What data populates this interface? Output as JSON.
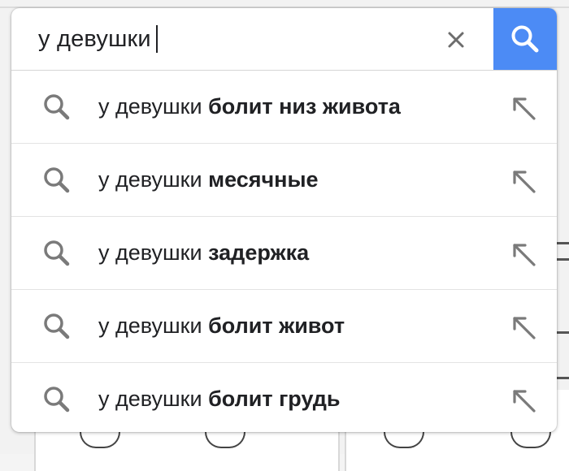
{
  "search": {
    "query": "у девушки",
    "clear_icon": "close-icon",
    "submit_icon": "search-icon",
    "submit_color": "#4c8bf5"
  },
  "suggestions": [
    {
      "prefix": "у девушки",
      "completion": "болит низ живота",
      "icon": "search-icon",
      "action_icon": "arrow-up-left-icon"
    },
    {
      "prefix": "у девушки",
      "completion": "месячные",
      "icon": "search-icon",
      "action_icon": "arrow-up-left-icon"
    },
    {
      "prefix": "у девушки",
      "completion": "задержка",
      "icon": "search-icon",
      "action_icon": "arrow-up-left-icon"
    },
    {
      "prefix": "у девушки",
      "completion": "болит живот",
      "icon": "search-icon",
      "action_icon": "arrow-up-left-icon"
    },
    {
      "prefix": "у девушки",
      "completion": "болит грудь",
      "icon": "search-icon",
      "action_icon": "arrow-up-left-icon"
    }
  ]
}
